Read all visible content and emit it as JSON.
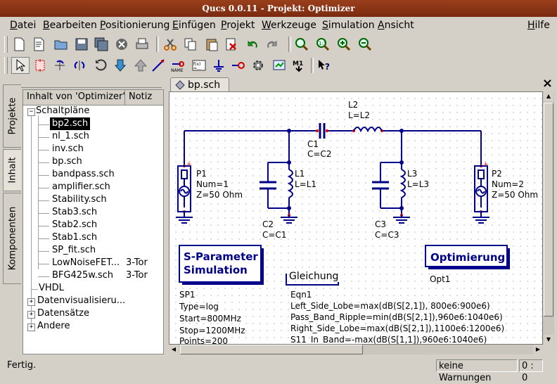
{
  "window": {
    "title": "Qucs 0.0.11 - Projekt: Optimizer"
  },
  "menu": [
    "Datei",
    "Bearbeiten",
    "Positionierung",
    "Einfügen",
    "Projekt",
    "Werkzeuge",
    "Simulation",
    "Ansicht",
    "Hilfe"
  ],
  "sidetabs": {
    "projects": "Projekte",
    "content": "Inhalt",
    "components": "Komponenten"
  },
  "tree": {
    "col_content": "Inhalt von 'Optimizer'",
    "col_note": "Notiz",
    "schematics_label": "Schaltpläne",
    "files": [
      {
        "name": "bp2.sch",
        "note": ""
      },
      {
        "name": "nl_1.sch",
        "note": ""
      },
      {
        "name": "inv.sch",
        "note": ""
      },
      {
        "name": "bp.sch",
        "note": ""
      },
      {
        "name": "bandpass.sch",
        "note": ""
      },
      {
        "name": "amplifier.sch",
        "note": ""
      },
      {
        "name": "Stability.sch",
        "note": ""
      },
      {
        "name": "Stab3.sch",
        "note": ""
      },
      {
        "name": "Stab2.sch",
        "note": ""
      },
      {
        "name": "Stab1.sch",
        "note": ""
      },
      {
        "name": "SP_fit.sch",
        "note": ""
      },
      {
        "name": "LowNoiseFET...",
        "note": "3-Tor"
      },
      {
        "name": "BFG425w.sch",
        "note": "3-Tor"
      }
    ],
    "vhdl": "VHDL",
    "datavis": "Datenvisualisieru...",
    "datasets": "Datensätze",
    "other": "Andere"
  },
  "document_tab": "bp.sch",
  "schematic": {
    "l2": [
      "L2",
      "L=L2"
    ],
    "c1": [
      "C1",
      "C=C2"
    ],
    "l1": [
      "L1",
      "L=L1"
    ],
    "c2": [
      "C2",
      "C=C1"
    ],
    "l3": [
      "L3",
      "L=L3"
    ],
    "c3": [
      "C3",
      "C=C3"
    ],
    "p1": [
      "P1",
      "Num=1",
      "Z=50 Ohm"
    ],
    "p2": [
      "P2",
      "Num=2",
      "Z=50 Ohm"
    ],
    "sparam_box": [
      "S-Parameter",
      "Simulation"
    ],
    "sparam_props": [
      "SP1",
      "Type=log",
      "Start=800MHz",
      "Stop=1200MHz",
      "Points=200"
    ],
    "eqn_title": "Gleichung",
    "eqn_props": [
      "Eqn1",
      "Left_Side_Lobe=max(dB(S[2,1]), 800e6:900e6)",
      "Pass_Band_Ripple=min(dB(S[2,1]),960e6:1040e6)",
      "Right_Side_Lobe=max(dB(S[2,1]),1100e6:1200e6)",
      "S11_In_Band=-max(dB(S[1,1]),960e6:1040e6)"
    ],
    "opt_box": "Optimierung",
    "opt_label": "Opt1"
  },
  "status": {
    "message": "Fertig.",
    "warnings": "keine Warnungen",
    "position": "0 : 0"
  }
}
